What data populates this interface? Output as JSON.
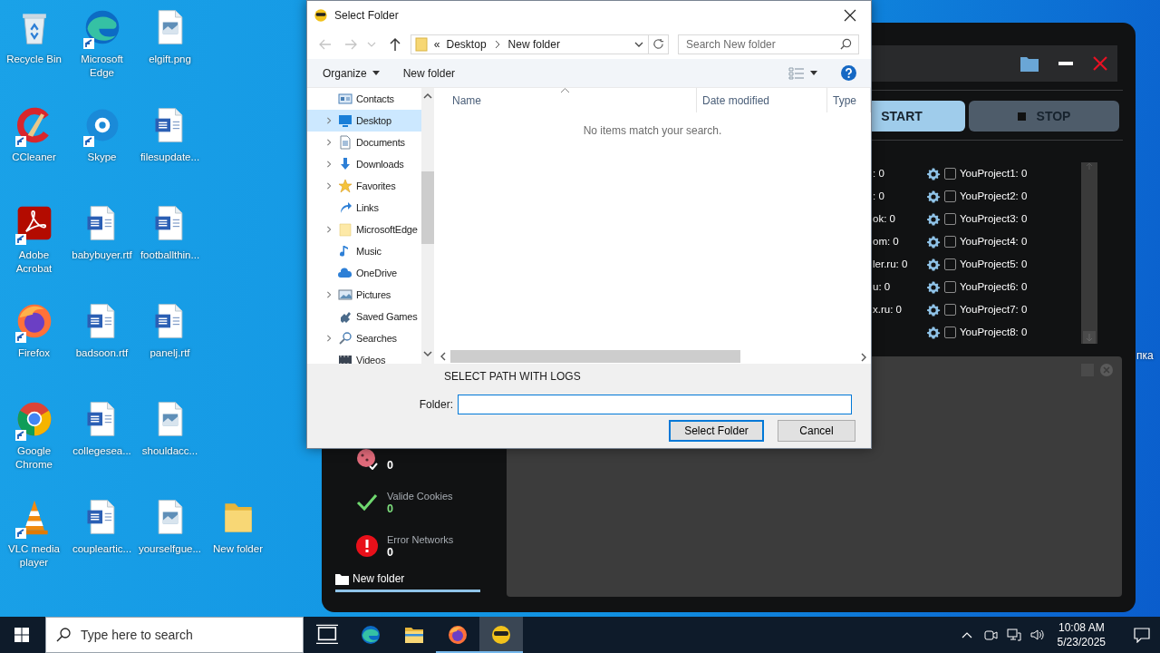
{
  "desktop": {
    "icon_rows": [
      [
        {
          "label": "Recycle Bin",
          "kind": "recycle",
          "shortcut": false
        },
        {
          "label": "Microsoft Edge",
          "kind": "edge",
          "shortcut": true
        },
        {
          "label": "elgift.png",
          "kind": "image",
          "shortcut": false
        }
      ],
      [
        {
          "label": "CCleaner",
          "kind": "ccleaner",
          "shortcut": true
        },
        {
          "label": "Skype",
          "kind": "skype",
          "shortcut": true
        },
        {
          "label": "filesupdate...",
          "kind": "word",
          "shortcut": false
        }
      ],
      [
        {
          "label": "Adobe Acrobat",
          "kind": "acrobat",
          "shortcut": true
        },
        {
          "label": "babybuyer.rtf",
          "kind": "word",
          "shortcut": false
        },
        {
          "label": "footballthin...",
          "kind": "word",
          "shortcut": false
        }
      ],
      [
        {
          "label": "Firefox",
          "kind": "firefox",
          "shortcut": true
        },
        {
          "label": "badsoon.rtf",
          "kind": "word",
          "shortcut": false
        },
        {
          "label": "panelj.rtf",
          "kind": "word",
          "shortcut": false
        }
      ],
      [
        {
          "label": "Google Chrome",
          "kind": "chrome",
          "shortcut": true
        },
        {
          "label": "collegesea...",
          "kind": "word",
          "shortcut": false
        },
        {
          "label": "shouldacc...",
          "kind": "image",
          "shortcut": false
        }
      ],
      [
        {
          "label": "VLC media player",
          "kind": "vlc",
          "shortcut": true
        },
        {
          "label": "coupleartic...",
          "kind": "word",
          "shortcut": false
        },
        {
          "label": "yourselfgue...",
          "kind": "image",
          "shortcut": false
        },
        {
          "label": "New folder",
          "kind": "folder",
          "shortcut": false
        }
      ]
    ],
    "partial_label": "пка"
  },
  "app_window": {
    "buttons": [
      {
        "label": "START",
        "kind": "start"
      },
      {
        "label": "STOP",
        "kind": "stop"
      }
    ],
    "left_counts": [
      ": 0",
      ": 0",
      "ok: 0",
      "om: 0",
      "ler.ru: 0",
      "u: 0",
      "x.ru: 0"
    ],
    "projects": [
      {
        "label": "YouProject1: 0",
        "checked": false
      },
      {
        "label": "YouProject2: 0",
        "checked": false
      },
      {
        "label": "YouProject3: 0",
        "checked": false
      },
      {
        "label": "YouProject4: 0",
        "checked": false
      },
      {
        "label": "YouProject5: 0",
        "checked": false
      },
      {
        "label": "YouProject6: 0",
        "checked": false
      },
      {
        "label": "YouProject7: 0",
        "checked": false
      },
      {
        "label": "YouProject8: 0",
        "checked": false
      }
    ],
    "stats": [
      {
        "kind": "cookies",
        "value": "0"
      },
      {
        "kind": "valid",
        "label": "Valide Cookies",
        "value": "0"
      },
      {
        "kind": "error",
        "label": "Error Networks",
        "value": "0"
      }
    ],
    "tabs": [
      {
        "label": "New folder",
        "selected": true
      }
    ]
  },
  "dialog": {
    "title": "Select Folder",
    "nav_buttons": [
      {
        "kind": "back",
        "disabled": true
      },
      {
        "kind": "forward",
        "disabled": true
      },
      {
        "kind": "recent",
        "disabled": true
      },
      {
        "kind": "up",
        "disabled": false
      }
    ],
    "address": {
      "overflow": "«",
      "crumbs": [
        "Desktop",
        "New folder"
      ]
    },
    "search": {
      "placeholder": "Search New folder"
    },
    "toolbar": {
      "organize": "Organize",
      "new_folder": "New folder"
    },
    "tree": [
      {
        "label": "Contacts",
        "kind": "contacts",
        "expandable": false,
        "selected": false
      },
      {
        "label": "Desktop",
        "kind": "desktop",
        "expandable": true,
        "selected": true
      },
      {
        "label": "Documents",
        "kind": "documents",
        "expandable": true,
        "selected": false
      },
      {
        "label": "Downloads",
        "kind": "downloads",
        "expandable": true,
        "selected": false
      },
      {
        "label": "Favorites",
        "kind": "favorites",
        "expandable": true,
        "selected": false
      },
      {
        "label": "Links",
        "kind": "links",
        "expandable": false,
        "selected": false
      },
      {
        "label": "MicrosoftEdge",
        "kind": "folder",
        "expandable": true,
        "selected": false
      },
      {
        "label": "Music",
        "kind": "music",
        "expandable": false,
        "selected": false
      },
      {
        "label": "OneDrive",
        "kind": "onedrive",
        "expandable": false,
        "selected": false
      },
      {
        "label": "Pictures",
        "kind": "pictures",
        "expandable": true,
        "selected": false
      },
      {
        "label": "Saved Games",
        "kind": "games",
        "expandable": false,
        "selected": false
      },
      {
        "label": "Searches",
        "kind": "search",
        "expandable": true,
        "selected": false
      },
      {
        "label": "Videos",
        "kind": "videos",
        "expandable": false,
        "selected": false
      }
    ],
    "columns": [
      "Name",
      "Date modified",
      "Type"
    ],
    "empty_message": "No items match your search.",
    "prompt": "SELECT PATH WITH LOGS",
    "folder_label": "Folder:",
    "buttons": [
      {
        "label": "Select Folder",
        "default": true
      },
      {
        "label": "Cancel",
        "default": false
      }
    ]
  },
  "taskbar": {
    "search": {
      "placeholder": "Type here to search"
    },
    "apps": [
      {
        "kind": "taskview",
        "running": false,
        "active": false
      },
      {
        "kind": "edge",
        "running": false,
        "active": false
      },
      {
        "kind": "explorer",
        "running": false,
        "active": false
      },
      {
        "kind": "firefox",
        "running": true,
        "active": false
      },
      {
        "kind": "app",
        "running": true,
        "active": true
      }
    ],
    "clock": {
      "time": "10:08 AM",
      "date": "5/23/2025"
    }
  }
}
